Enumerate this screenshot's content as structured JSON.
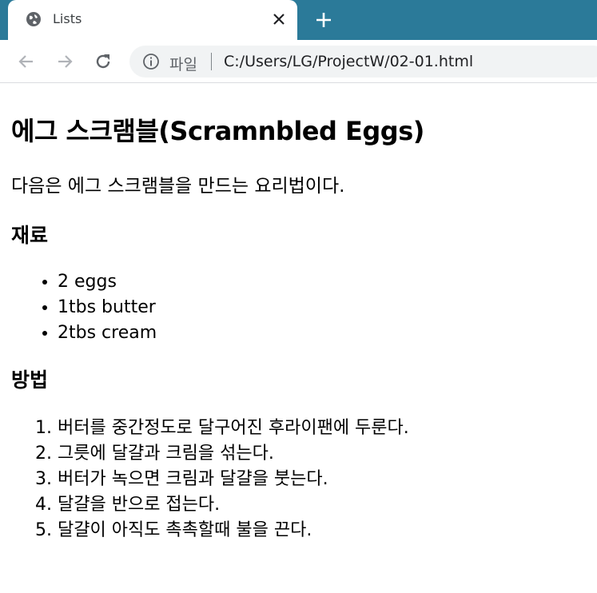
{
  "browser": {
    "tab_title": "Lists",
    "address_scheme_label": "파일",
    "address_url": "C:/Users/LG/ProjectW/02-01.html"
  },
  "page": {
    "title": "에그 스크램블(Scramnbled Eggs)",
    "intro": "다음은 에그 스크램블을 만드는 요리법이다.",
    "ingredients_heading": "재료",
    "ingredients": [
      "2 eggs",
      "1tbs butter",
      "2tbs cream"
    ],
    "method_heading": "방법",
    "steps": [
      "버터를 중간정도로 달구어진 후라이팬에 두룬다.",
      "그릇에 달걀과 크림을 섞는다.",
      "버터가 녹으면 크림과 달걀을 붓는다.",
      "달걀을 반으로 접는다.",
      "달걀이 아직도 촉촉할때 불을 끈다."
    ]
  },
  "colors": {
    "tabstrip_bg": "#2b7a99",
    "omnibox_bg": "#f1f3f4"
  }
}
